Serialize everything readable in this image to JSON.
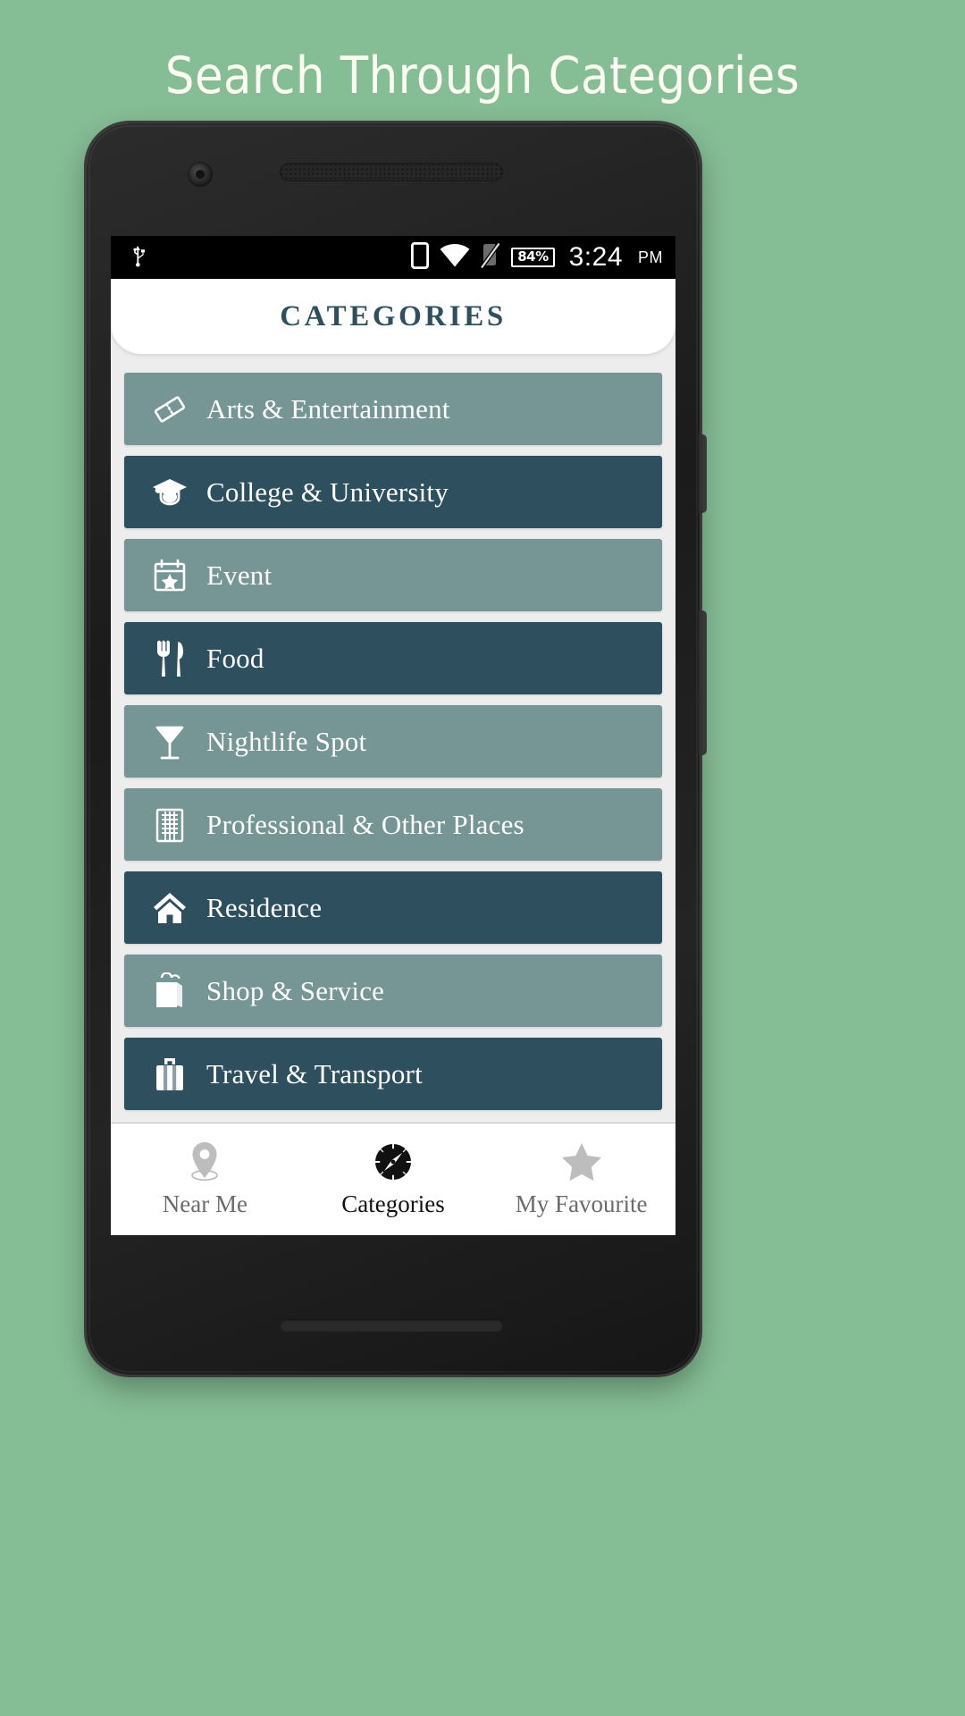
{
  "promo": {
    "headline": "Search Through Categories"
  },
  "statusbar": {
    "usb_icon": "usb-icon",
    "device_icon": "device-icon",
    "wifi_icon": "wifi-icon",
    "signal_off_icon": "cellular-signal-off-icon",
    "battery_percent": "84%",
    "time": "3:24",
    "meridiem": "PM"
  },
  "appbar": {
    "title": "CATEGORIES"
  },
  "categories": [
    {
      "label": "Arts & Entertainment",
      "icon": "ticket-icon",
      "tone": "light"
    },
    {
      "label": "College & University",
      "icon": "graduation-cap-icon",
      "tone": "dark"
    },
    {
      "label": "Event",
      "icon": "calendar-star-icon",
      "tone": "light"
    },
    {
      "label": "Food",
      "icon": "fork-knife-icon",
      "tone": "dark"
    },
    {
      "label": "Nightlife Spot",
      "icon": "cocktail-glass-icon",
      "tone": "light"
    },
    {
      "label": "Professional & Other Places",
      "icon": "office-building-icon",
      "tone": "light"
    },
    {
      "label": "Residence",
      "icon": "home-icon",
      "tone": "dark"
    },
    {
      "label": "Shop & Service",
      "icon": "shopping-bag-icon",
      "tone": "light"
    },
    {
      "label": "Travel & Transport",
      "icon": "suitcase-icon",
      "tone": "dark"
    }
  ],
  "bottom_nav": {
    "items": [
      {
        "label": "Near Me",
        "icon": "map-pin-icon",
        "active": false
      },
      {
        "label": "Categories",
        "icon": "compass-icon",
        "active": true
      },
      {
        "label": "My Favourite",
        "icon": "star-icon",
        "active": false
      }
    ]
  },
  "colors": {
    "background": "#85bd95",
    "row_light": "#759694",
    "row_dark": "#2d4f5e",
    "accent_text": "#2d4f5e",
    "screen_bg": "#ededed"
  }
}
